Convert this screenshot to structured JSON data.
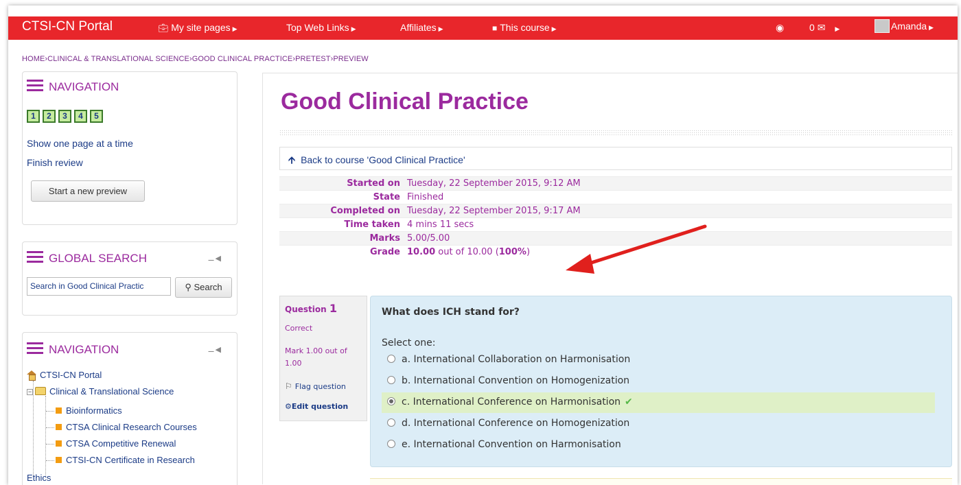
{
  "topbar": {
    "brand": "CTSI-CN Portal",
    "menus": [
      {
        "icon": "briefcase-icon",
        "label": "My site pages"
      },
      {
        "icon": "",
        "label": "Top Web Links"
      },
      {
        "icon": "",
        "label": "Affiliates"
      },
      {
        "icon": "book-icon",
        "label": "This course"
      }
    ],
    "messages": "0",
    "user": "Amanda"
  },
  "breadcrumb": [
    "HOME",
    "CLINICAL & TRANSLATIONAL SCIENCE",
    "GOOD CLINICAL PRACTICE",
    "PRETEST",
    "PREVIEW"
  ],
  "quiz_nav": {
    "title": "NAVIGATION",
    "pages": [
      "1",
      "2",
      "3",
      "4",
      "5"
    ],
    "show_one_page": "Show one page at a time",
    "finish_review": "Finish review",
    "new_preview": "Start a new preview"
  },
  "global_search": {
    "title": "GLOBAL SEARCH",
    "placeholder": "Search in Good Clinical Practic",
    "button": "Search"
  },
  "navigation": {
    "title": "NAVIGATION",
    "root": "CTSI-CN Portal",
    "category": "Clinical & Translational Science",
    "courses": [
      "Bioinformatics",
      "CTSA Clinical Research Courses",
      "CTSA Competitive Renewal",
      "CTSI-CN Certificate in Research"
    ],
    "next": "Ethics"
  },
  "main": {
    "title": "Good Clinical Practice",
    "back_link": "Back to course 'Good Clinical Practice'",
    "summary": [
      {
        "key": "Started on",
        "value": "Tuesday, 22 September 2015, 9:12 AM"
      },
      {
        "key": "State",
        "value": "Finished"
      },
      {
        "key": "Completed on",
        "value": "Tuesday, 22 September 2015, 9:17 AM"
      },
      {
        "key": "Time taken",
        "value": "4 mins 11 secs"
      },
      {
        "key": "Marks",
        "value": "5.00/5.00"
      }
    ],
    "grade": {
      "key": "Grade",
      "score": "10.00",
      "mid": " out of 10.00 (",
      "percent": "100%",
      "end": ")"
    }
  },
  "question": {
    "label": "Question",
    "number": "1",
    "status": "Correct",
    "mark_line1": "Mark 1.00 out of",
    "mark_line2": "1.00",
    "flag": "Flag question",
    "edit": "Edit question",
    "text": "What does ICH stand for?",
    "prompt": "Select one:",
    "options": [
      "a. International Collaboration on Harmonisation",
      "b. International Convention on Homogenization",
      "c. International Conference on Harmonisation",
      "d. International Conference on Homogenization",
      "e. International Convention on Harmonisation"
    ],
    "selected_index": 2
  },
  "colors": {
    "topbar": "#e8262b",
    "accent": "#9b2a9e",
    "link": "#1b3b86",
    "correct_bg": "#dff0c7",
    "annotation": "#e0201d"
  }
}
